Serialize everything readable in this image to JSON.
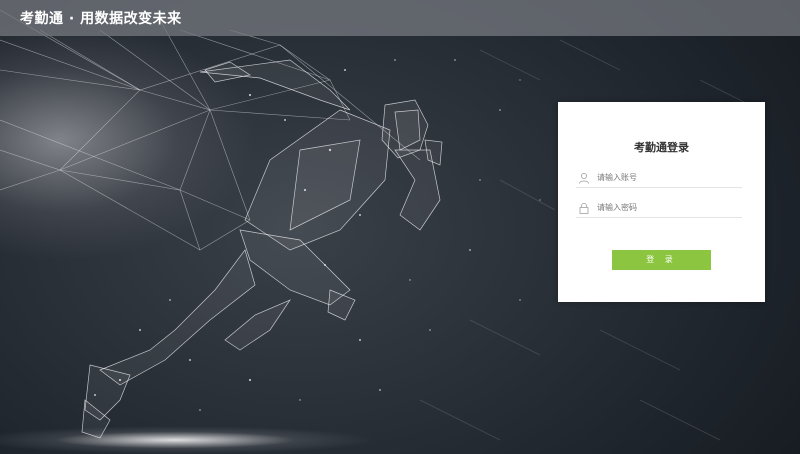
{
  "header": {
    "title": "考勤通 · 用数据改变未来"
  },
  "login": {
    "title": "考勤通登录",
    "username_placeholder": "请输入账号",
    "password_placeholder": "请输入密码",
    "submit_label": "登 录"
  },
  "colors": {
    "accent": "#8cc53f",
    "background": "#1d232b",
    "card": "#ffffff"
  },
  "icons": {
    "username": "user-icon",
    "password": "lock-icon"
  }
}
